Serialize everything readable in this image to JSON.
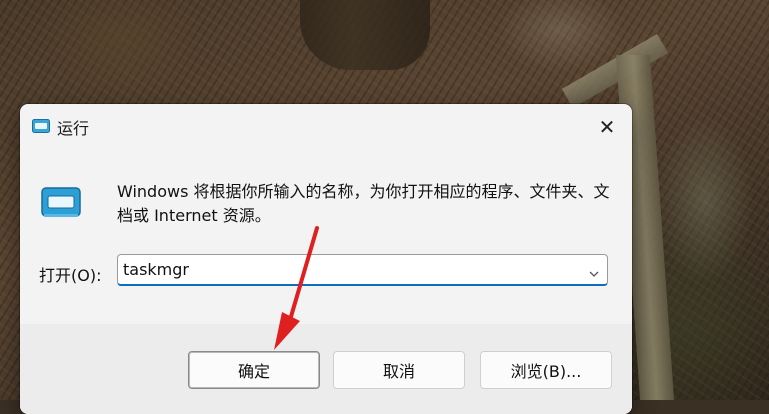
{
  "dialog": {
    "title": "运行",
    "title_icon": "run-icon",
    "close_icon": "close-icon",
    "description": "Windows 将根据你所输入的名称，为你打开相应的程序、文件夹、文档或 Internet 资源。",
    "open_label": "打开(O):",
    "command_value": "taskmgr",
    "dropdown_icon": "chevron-down-icon",
    "buttons": {
      "ok": "确定",
      "cancel": "取消",
      "browse": "浏览(B)..."
    }
  },
  "annotation": {
    "arrow_color": "#e02020",
    "points_to": "ok-button"
  },
  "colors": {
    "accent": "#0f6cbd",
    "dialog_bg": "#f3f3f3",
    "footer_bg": "#ececec"
  }
}
